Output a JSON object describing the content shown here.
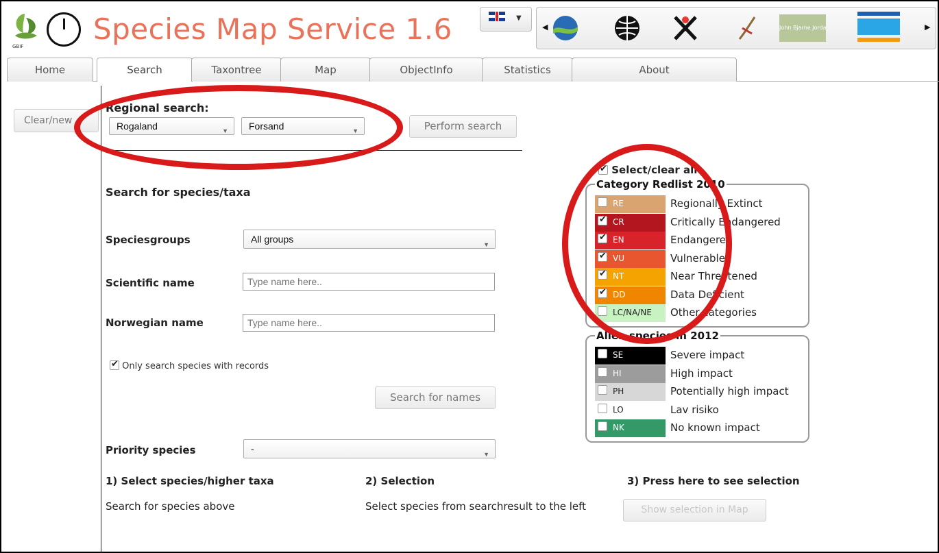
{
  "app": {
    "title": "Species Map Service 1.6",
    "logo_label": "GBIF"
  },
  "language": {
    "icon": "uk-flag-icon"
  },
  "partners": {
    "logo_5_text": "John Bjarne Jordal"
  },
  "tabs": [
    "Home",
    "Search",
    "Taxontree",
    "Map",
    "ObjectInfo",
    "Statistics",
    "About"
  ],
  "clear_button": "Clear/new",
  "regional": {
    "heading": "Regional search:",
    "county": "Rogaland",
    "municipality": "Forsand",
    "perform_button": "Perform search"
  },
  "search": {
    "heading": "Search for species/taxa",
    "speciesgroups_label": "Speciesgroups",
    "speciesgroups_value": "All groups",
    "scientific_label": "Scientific name",
    "scientific_placeholder": "Type name here..",
    "norwegian_label": "Norwegian name",
    "norwegian_placeholder": "Type name here..",
    "only_records_label": "Only search species with records",
    "search_names_button": "Search for names",
    "priority_label": "Priority species",
    "priority_value": "-"
  },
  "steps": {
    "step1_title": "1) Select species/higher taxa",
    "step1_text": "Search for species above",
    "step2_title": "2) Selection",
    "step2_text": "Select species from searchresult to the left",
    "step3_title": "3) Press here to see selection",
    "step3_button": "Show selection in Map"
  },
  "redlist": {
    "select_all": "Select/clear all",
    "legend": "Category Redlist 2010",
    "items": [
      {
        "code": "RE",
        "label": "Regionally Extinct",
        "checked": false,
        "color": "#d9a46f",
        "text_color": "#fff"
      },
      {
        "code": "CR",
        "label": "Critically Endangered",
        "checked": true,
        "color": "#b3161e",
        "text_color": "#fff"
      },
      {
        "code": "EN",
        "label": "Endangered",
        "checked": true,
        "color": "#d9232a",
        "text_color": "#fff"
      },
      {
        "code": "VU",
        "label": "Vulnerable",
        "checked": true,
        "color": "#e8562f",
        "text_color": "#fff"
      },
      {
        "code": "NT",
        "label": "Near Threatened",
        "checked": true,
        "color": "#f5a300",
        "text_color": "#fff"
      },
      {
        "code": "DD",
        "label": "Data Deficient",
        "checked": true,
        "color": "#f08500",
        "text_color": "#fff"
      },
      {
        "code": "LC/NA/NE",
        "label": "Other categories",
        "checked": false,
        "color": "#c9f2c3",
        "text_color": "#222"
      }
    ]
  },
  "alien": {
    "legend": "Alien species in 2012",
    "items": [
      {
        "code": "SE",
        "label": "Severe impact",
        "checked": false,
        "color": "#000000",
        "text_color": "#fff"
      },
      {
        "code": "HI",
        "label": "High impact",
        "checked": false,
        "color": "#9c9c9c",
        "text_color": "#fff"
      },
      {
        "code": "PH",
        "label": "Potentially high impact",
        "checked": false,
        "color": "#d7d7d7",
        "text_color": "#222"
      },
      {
        "code": "LO",
        "label": "Lav risiko",
        "checked": false,
        "color": "#ffffff",
        "text_color": "#222"
      },
      {
        "code": "NK",
        "label": "No known impact",
        "checked": false,
        "color": "#339966",
        "text_color": "#fff"
      }
    ]
  },
  "annotation_color": "#d81a1a"
}
